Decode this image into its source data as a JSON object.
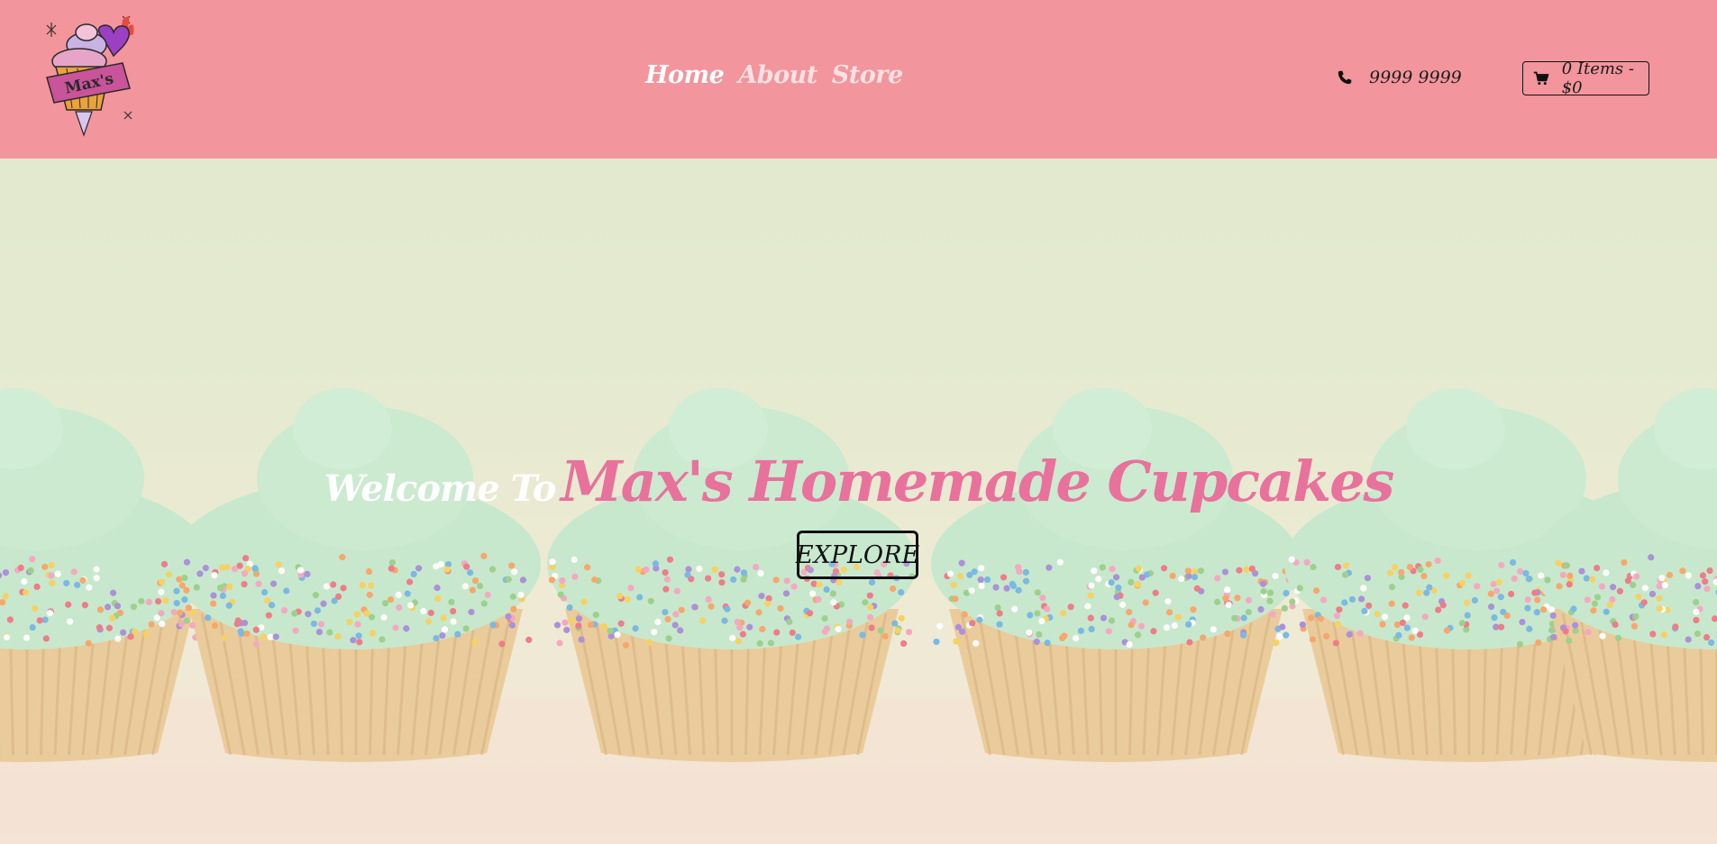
{
  "logo": {
    "text": "Max's"
  },
  "nav": {
    "items": [
      {
        "label": "Home",
        "active": true
      },
      {
        "label": "About",
        "active": false
      },
      {
        "label": "Store",
        "active": false
      }
    ]
  },
  "contact": {
    "icon": "phone-icon",
    "phone": "9999 9999"
  },
  "cart": {
    "icon": "shopping-cart-icon",
    "label": "0 Items - $0"
  },
  "hero": {
    "welcome": "Welcome To",
    "brand": "Max's Homemade Cupcakes",
    "button": "EXPLORE"
  },
  "colors": {
    "header_bg": "#f3959c",
    "brand_pink": "#e8729c",
    "frosting": "#b3e3c2"
  }
}
